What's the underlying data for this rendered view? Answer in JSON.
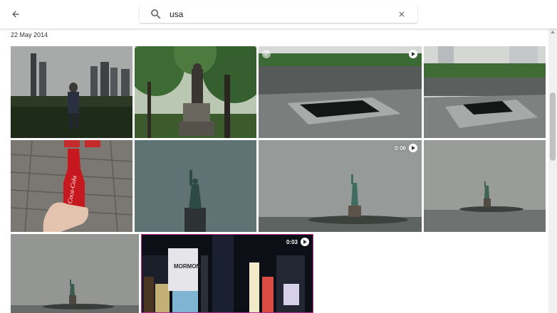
{
  "header": {
    "back_icon": "arrow-left-icon",
    "search": {
      "value": "usa",
      "placeholder": ""
    },
    "search_icon": "search-icon",
    "clear_icon": "close-icon"
  },
  "section": {
    "date": "22 May 2014"
  },
  "photos": [
    {
      "name": "central-park-skyline",
      "video": false
    },
    {
      "name": "statue-in-park",
      "video": false
    },
    {
      "name": "memorial-pool",
      "video": false,
      "badge": "play-icon"
    },
    {
      "name": "memorial-pool-2",
      "video": false
    },
    {
      "name": "coca-cola-bottle",
      "video": false,
      "bottle_text": "Coca-Cola"
    },
    {
      "name": "statue-of-liberty-close",
      "video": false
    },
    {
      "name": "statue-of-liberty-video",
      "video": true,
      "duration": "0:06"
    },
    {
      "name": "statue-of-liberty-far",
      "video": false
    },
    {
      "name": "statue-of-liberty-haze",
      "video": false
    },
    {
      "name": "times-square-video",
      "video": true,
      "duration": "0:03",
      "sign_text": "MORMON"
    }
  ],
  "colors": {
    "accent": "#ffffff",
    "sky_gray": "#8f9390",
    "foliage": "#2f5a2a"
  }
}
